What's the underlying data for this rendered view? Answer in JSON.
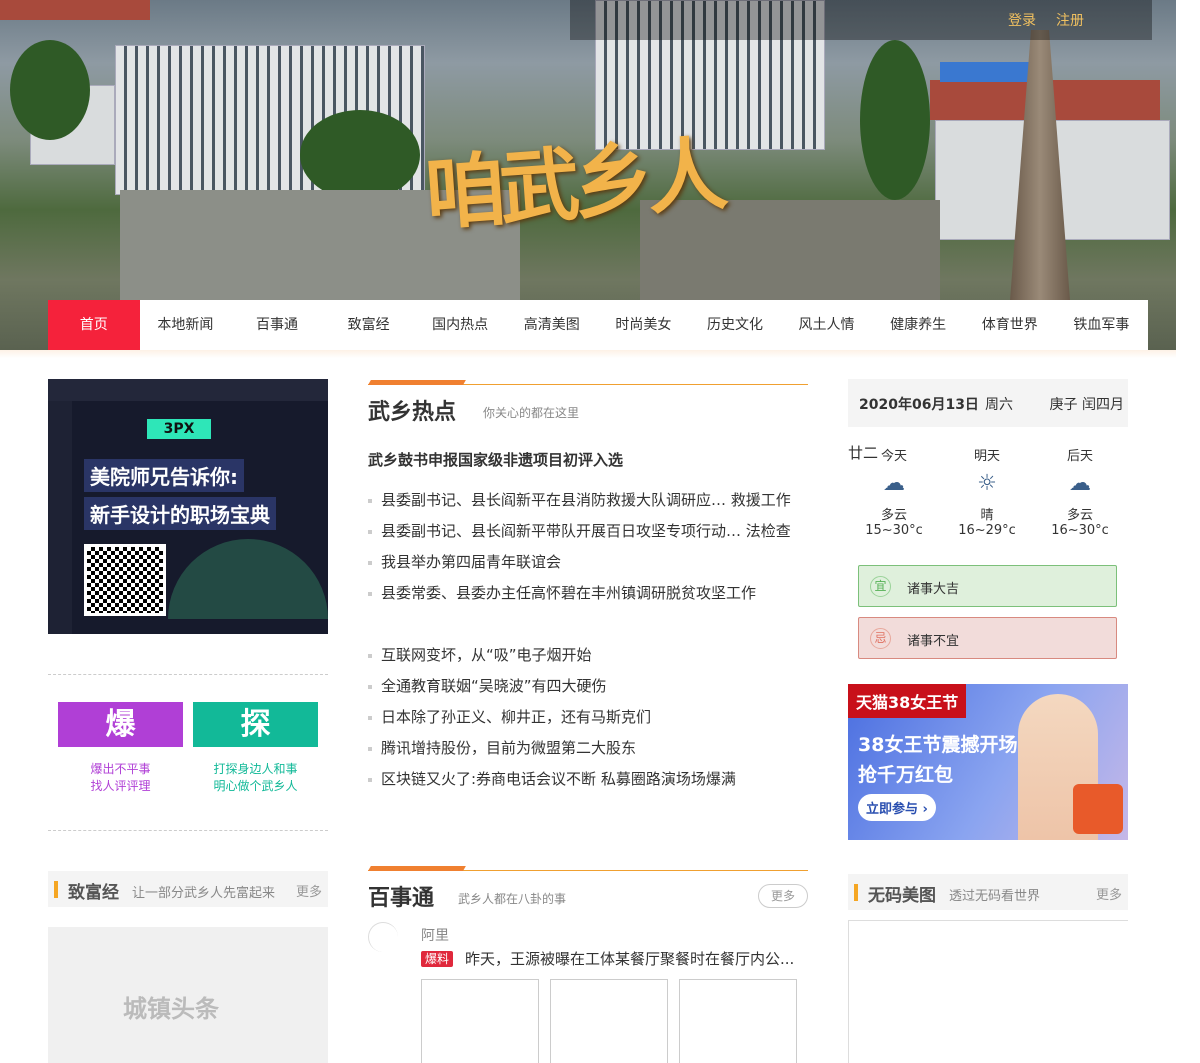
{
  "header": {
    "logo_text": "咱武乡人",
    "login": "登录",
    "register": "注册"
  },
  "nav": [
    "首页",
    "本地新闻",
    "百事通",
    "致富经",
    "国内热点",
    "高清美图",
    "时尚美女",
    "历史文化",
    "风土人情",
    "健康养生",
    "体育世界",
    "铁血军事"
  ],
  "left": {
    "ad": {
      "brand": "3PX",
      "line1": "美院师兄告诉你:",
      "line2": "新手设计的职场宝典"
    },
    "bao": {
      "icon": "爆",
      "line1": "爆出不平事",
      "line2": "找人评评理",
      "color": "#b03fd6"
    },
    "tan": {
      "icon": "探",
      "line1": "打探身边人和事",
      "line2": "明心做个武乡人",
      "color": "#12b998"
    },
    "zhifu": {
      "title": "致富经",
      "subtitle": "让一部分武乡人先富起来",
      "more": "更多",
      "image_text": "城镇头条"
    }
  },
  "hot": {
    "title": "武乡热点",
    "subtitle": "你关心的都在这里",
    "headline": "武乡鼓书申报国家级非遗项目初评入选",
    "group1": [
      "县委副书记、县长阎新平在县消防救援大队调研应… 救援工作",
      "县委副书记、县长阎新平带队开展百日攻坚专项行动… 法检查",
      "我县举办第四届青年联谊会",
      "县委常委、县委办主任高怀碧在丰州镇调研脱贫攻坚工作"
    ],
    "group2": [
      "互联网变坏，从“吸”电子烟开始",
      "全通教育联姻“吴晓波”有四大硬伤",
      "日本除了孙正义、柳井正，还有马斯克们",
      "腾讯增持股份，目前为微盟第二大股东",
      "区块链又火了:券商电话会议不断 私募圈路演场场爆满"
    ]
  },
  "baishi": {
    "title": "百事通",
    "subtitle": "武乡人都在八卦的事",
    "more": "更多",
    "author": "阿里",
    "tag": "爆料",
    "text": "昨天，王源被曝在工体某餐厅聚餐时在餐厅内公..."
  },
  "right": {
    "date": "2020年06月13日",
    "weekday": "周六",
    "lunar": "庚子 闰四月",
    "lunar_day": "廿二",
    "weather": [
      {
        "day": "今天",
        "icon": "cloudy-icon",
        "desc": "多云",
        "temp": "15~30°c"
      },
      {
        "day": "明天",
        "icon": "sunny-icon",
        "desc": "晴",
        "temp": "16~29°c"
      },
      {
        "day": "后天",
        "icon": "cloudy-icon",
        "desc": "多云",
        "temp": "16~30°c"
      }
    ],
    "yi": {
      "mark": "宜",
      "text": "诸事大吉"
    },
    "ji": {
      "mark": "忌",
      "text": "诸事不宜"
    },
    "ad": {
      "badge": "天猫38女王节",
      "line1": "38女王节震撼开场",
      "line2": "抢千万红包",
      "cta": "立即参与 ›"
    },
    "meitu": {
      "title": "无码美图",
      "subtitle": "透过无码看世界",
      "more": "更多"
    }
  }
}
